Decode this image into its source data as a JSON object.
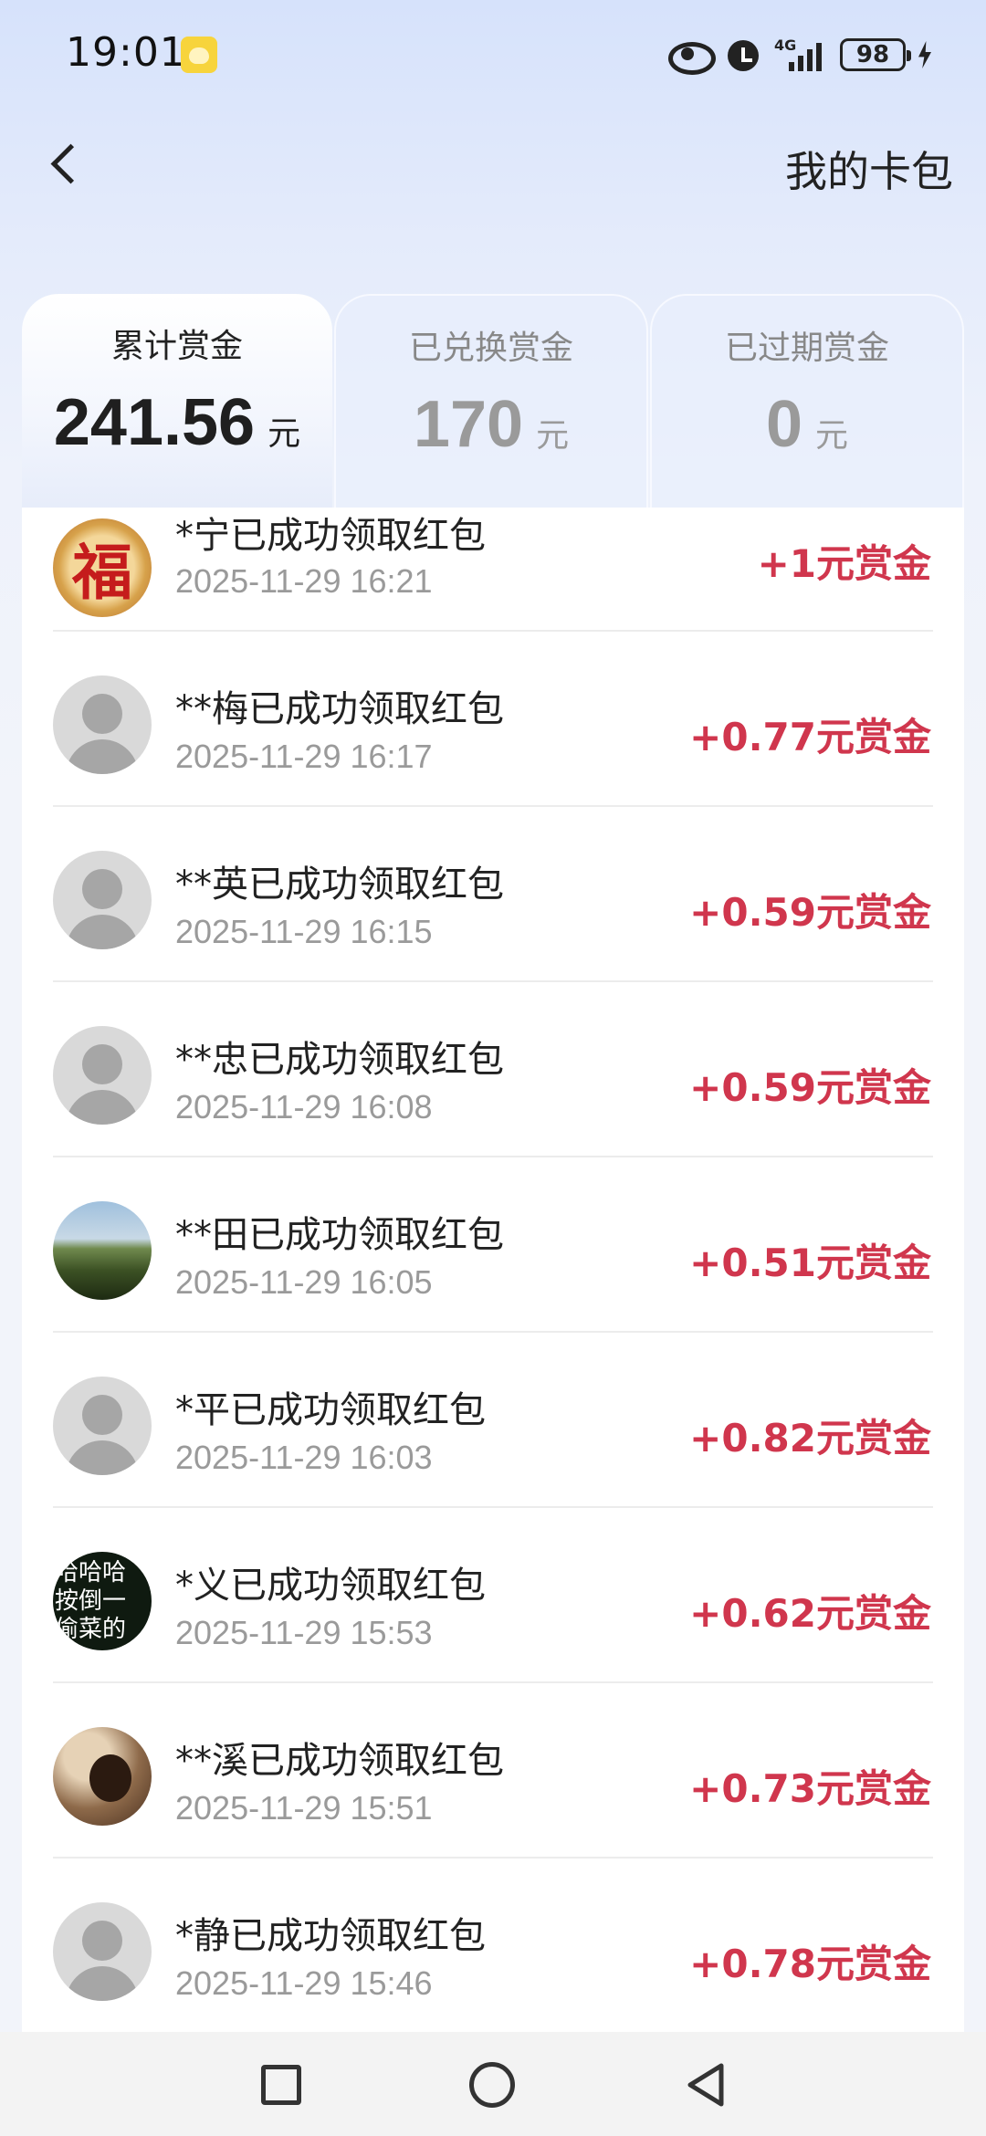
{
  "status_bar": {
    "time": "19:01",
    "network": "4G",
    "battery": "98",
    "icons": [
      "app-notification-icon",
      "eye-icon",
      "alarm-icon",
      "signal-icon",
      "battery-icon",
      "charging-icon"
    ]
  },
  "header": {
    "title": "我的卡包",
    "back_icon": "back-arrow-icon"
  },
  "tabs": [
    {
      "label": "累计赏金",
      "value": "241.56",
      "unit": "元",
      "active": true
    },
    {
      "label": "已兑换赏金",
      "value": "170",
      "unit": "元",
      "active": false
    },
    {
      "label": "已过期赏金",
      "value": "0",
      "unit": "元",
      "active": false
    }
  ],
  "records": [
    {
      "name": "*宁已成功领取红包",
      "time": "2025-11-29 16:21",
      "amount": "+1元赏金",
      "avatar": "fu-avatar"
    },
    {
      "name": "**梅已成功领取红包",
      "time": "2025-11-29 16:17",
      "amount": "+0.77元赏金",
      "avatar": "default-avatar"
    },
    {
      "name": "**英已成功领取红包",
      "time": "2025-11-29 16:15",
      "amount": "+0.59元赏金",
      "avatar": "default-avatar"
    },
    {
      "name": "**忠已成功领取红包",
      "time": "2025-11-29 16:08",
      "amount": "+0.59元赏金",
      "avatar": "default-avatar"
    },
    {
      "name": "**田已成功领取红包",
      "time": "2025-11-29 16:05",
      "amount": "+0.51元赏金",
      "avatar": "landscape-avatar"
    },
    {
      "name": "*平已成功领取红包",
      "time": "2025-11-29 16:03",
      "amount": "+0.82元赏金",
      "avatar": "default-avatar"
    },
    {
      "name": "*义已成功领取红包",
      "time": "2025-11-29 15:53",
      "amount": "+0.62元赏金",
      "avatar": "text-avatar"
    },
    {
      "name": "**溪已成功领取红包",
      "time": "2025-11-29 15:51",
      "amount": "+0.73元赏金",
      "avatar": "photo-avatar"
    },
    {
      "name": "*静已成功领取红包",
      "time": "2025-11-29 15:46",
      "amount": "+0.78元赏金",
      "avatar": "default-avatar"
    }
  ],
  "avatar_text": {
    "fu": "福",
    "text_lines": [
      "哈哈哈",
      "按倒一",
      "偷菜的"
    ]
  },
  "colors": {
    "amount": "#d0364d",
    "active_tab_text": "#1f1f1f",
    "inactive_tab_text": "#9a9a9a"
  },
  "nav_bar": {
    "buttons": [
      "recent-apps-icon",
      "home-icon",
      "back-icon"
    ]
  }
}
